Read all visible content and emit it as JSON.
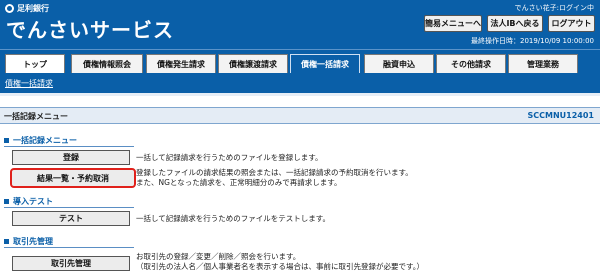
{
  "header": {
    "bank_name": "足利銀行",
    "service_title": "でんさいサービス",
    "login_status": "でんさい花子:ログイン中",
    "buttons": {
      "menu": "簡易メニューへ",
      "back": "法人IBへ戻る",
      "logout": "ログアウト"
    },
    "last_operation": "最終操作日時：2019/10/09 10:00:00"
  },
  "tabs": [
    {
      "label": "トップ"
    },
    {
      "label": "債権情報照会"
    },
    {
      "label": "債権発生請求"
    },
    {
      "label": "債権譲渡請求"
    },
    {
      "label": "債権一括請求"
    },
    {
      "label": "融資申込"
    },
    {
      "label": "その他請求"
    },
    {
      "label": "管理業務"
    }
  ],
  "subnav": {
    "link": "債権一括請求"
  },
  "screen": {
    "title": "一括記録メニュー",
    "id": "SCCMNU12401"
  },
  "sections": [
    {
      "heading": "一括記録メニュー",
      "items": [
        {
          "button": "登録",
          "description": [
            "一括して記録請求を行うためのファイルを登録します。"
          ]
        },
        {
          "button": "結果一覧・予約取消",
          "description": [
            "登録したファイルの請求結果の照会または、一括記録請求の予約取消を行います。",
            "また、NGとなった請求を、正常明細分のみで再請求します。"
          ]
        }
      ]
    },
    {
      "heading": "導入テスト",
      "items": [
        {
          "button": "テスト",
          "description": [
            "一括して記録請求を行うためのファイルをテストします。"
          ]
        }
      ]
    },
    {
      "heading": "取引先管理",
      "items": [
        {
          "button": "取引先管理",
          "description": [
            "お取引先の登録／変更／削除／照会を行います。",
            "（取引先の法人名／個人事業者名を表示する場合は、事前に取引先登録が必要です。）"
          ]
        }
      ]
    }
  ],
  "colors": {
    "brand": "#0a5fa8",
    "highlight_border": "#e0211b"
  }
}
